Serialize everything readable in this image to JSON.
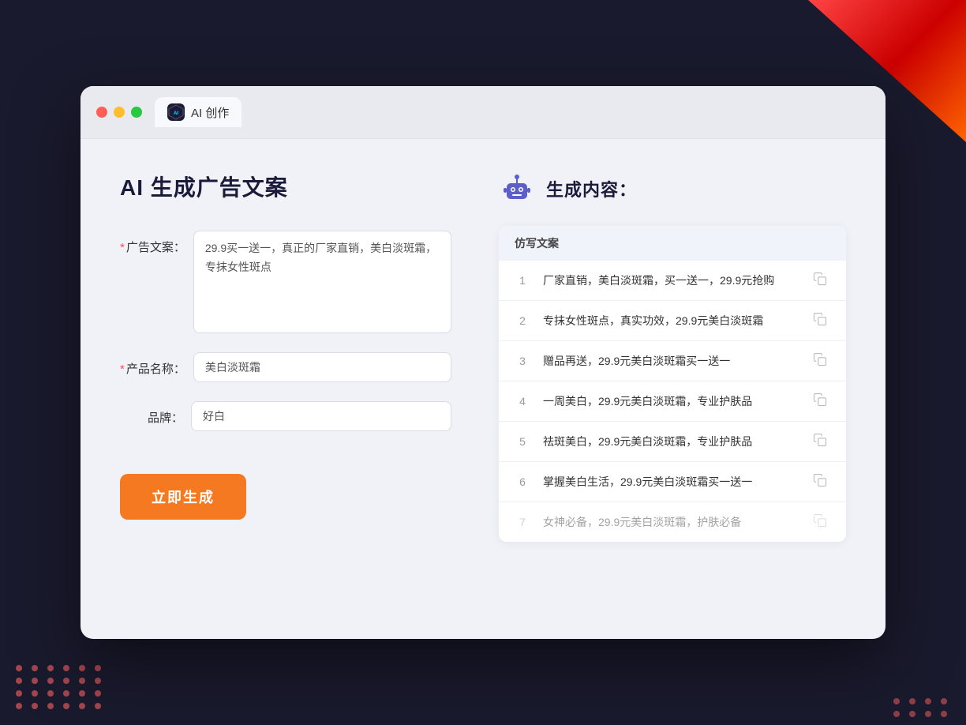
{
  "background": {
    "color": "#1a1a2e"
  },
  "browser": {
    "tab_icon_text": "AI",
    "tab_label": "AI 创作",
    "traffic_lights": [
      "red",
      "yellow",
      "green"
    ]
  },
  "left_panel": {
    "page_title": "AI 生成广告文案",
    "form": {
      "ad_copy_label": "广告文案：",
      "ad_copy_required": true,
      "ad_copy_value": "29.9买一送一，真正的厂家直销，美白淡斑霜，专抹女性斑点",
      "product_name_label": "产品名称：",
      "product_name_required": true,
      "product_name_value": "美白淡斑霜",
      "brand_label": "品牌：",
      "brand_required": false,
      "brand_value": "好白"
    },
    "generate_button": "立即生成"
  },
  "right_panel": {
    "section_title": "生成内容：",
    "results_header": "仿写文案",
    "results": [
      {
        "num": "1",
        "text": "厂家直销，美白淡斑霜，买一送一，29.9元抢购",
        "faded": false
      },
      {
        "num": "2",
        "text": "专抹女性斑点，真实功效，29.9元美白淡斑霜",
        "faded": false
      },
      {
        "num": "3",
        "text": "赠品再送，29.9元美白淡斑霜买一送一",
        "faded": false
      },
      {
        "num": "4",
        "text": "一周美白，29.9元美白淡斑霜，专业护肤品",
        "faded": false
      },
      {
        "num": "5",
        "text": "祛斑美白，29.9元美白淡斑霜，专业护肤品",
        "faded": false
      },
      {
        "num": "6",
        "text": "掌握美白生活，29.9元美白淡斑霜买一送一",
        "faded": false
      },
      {
        "num": "7",
        "text": "女神必备，29.9元美白淡斑霜，护肤必备",
        "faded": true
      }
    ]
  }
}
